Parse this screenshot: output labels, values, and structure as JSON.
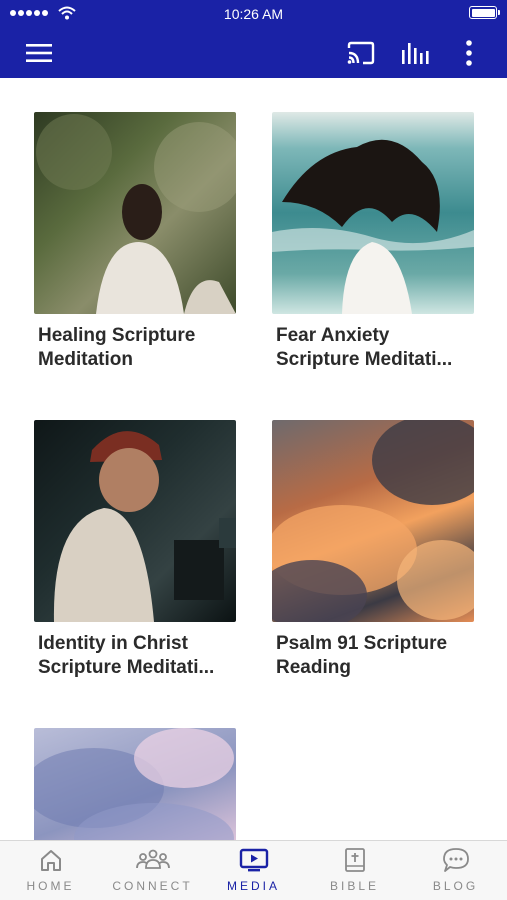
{
  "status_bar": {
    "time": "10:26 AM"
  },
  "media": {
    "items": [
      {
        "title_line1": "Healing Scripture",
        "title_line2": "Meditation",
        "image": "woman-praying-forest-photo"
      },
      {
        "title_line1": "Fear Anxiety",
        "title_line2": "Scripture Meditati...",
        "image": "woman-hair-blowing-sea-photo"
      },
      {
        "title_line1": "Identity in Christ",
        "title_line2": "Scripture Meditati...",
        "image": "man-with-camera-photo"
      },
      {
        "title_line1": "Psalm 91 Scripture",
        "title_line2": "Reading",
        "image": "orange-clouds-sky-photo"
      },
      {
        "title_line1": "",
        "title_line2": "",
        "image": "pastel-clouds-sky-photo"
      }
    ]
  },
  "tabs": [
    {
      "label": "HOME",
      "icon": "home-icon",
      "active": false
    },
    {
      "label": "CONNECT",
      "icon": "people-icon",
      "active": false
    },
    {
      "label": "MEDIA",
      "icon": "tv-play-icon",
      "active": true
    },
    {
      "label": "BIBLE",
      "icon": "bible-icon",
      "active": false
    },
    {
      "label": "BLOG",
      "icon": "chat-bubble-icon",
      "active": false
    }
  ],
  "colors": {
    "brand": "#1a22a6",
    "tab_inactive": "#8a8a8a",
    "title_text": "#2b2b2b"
  }
}
